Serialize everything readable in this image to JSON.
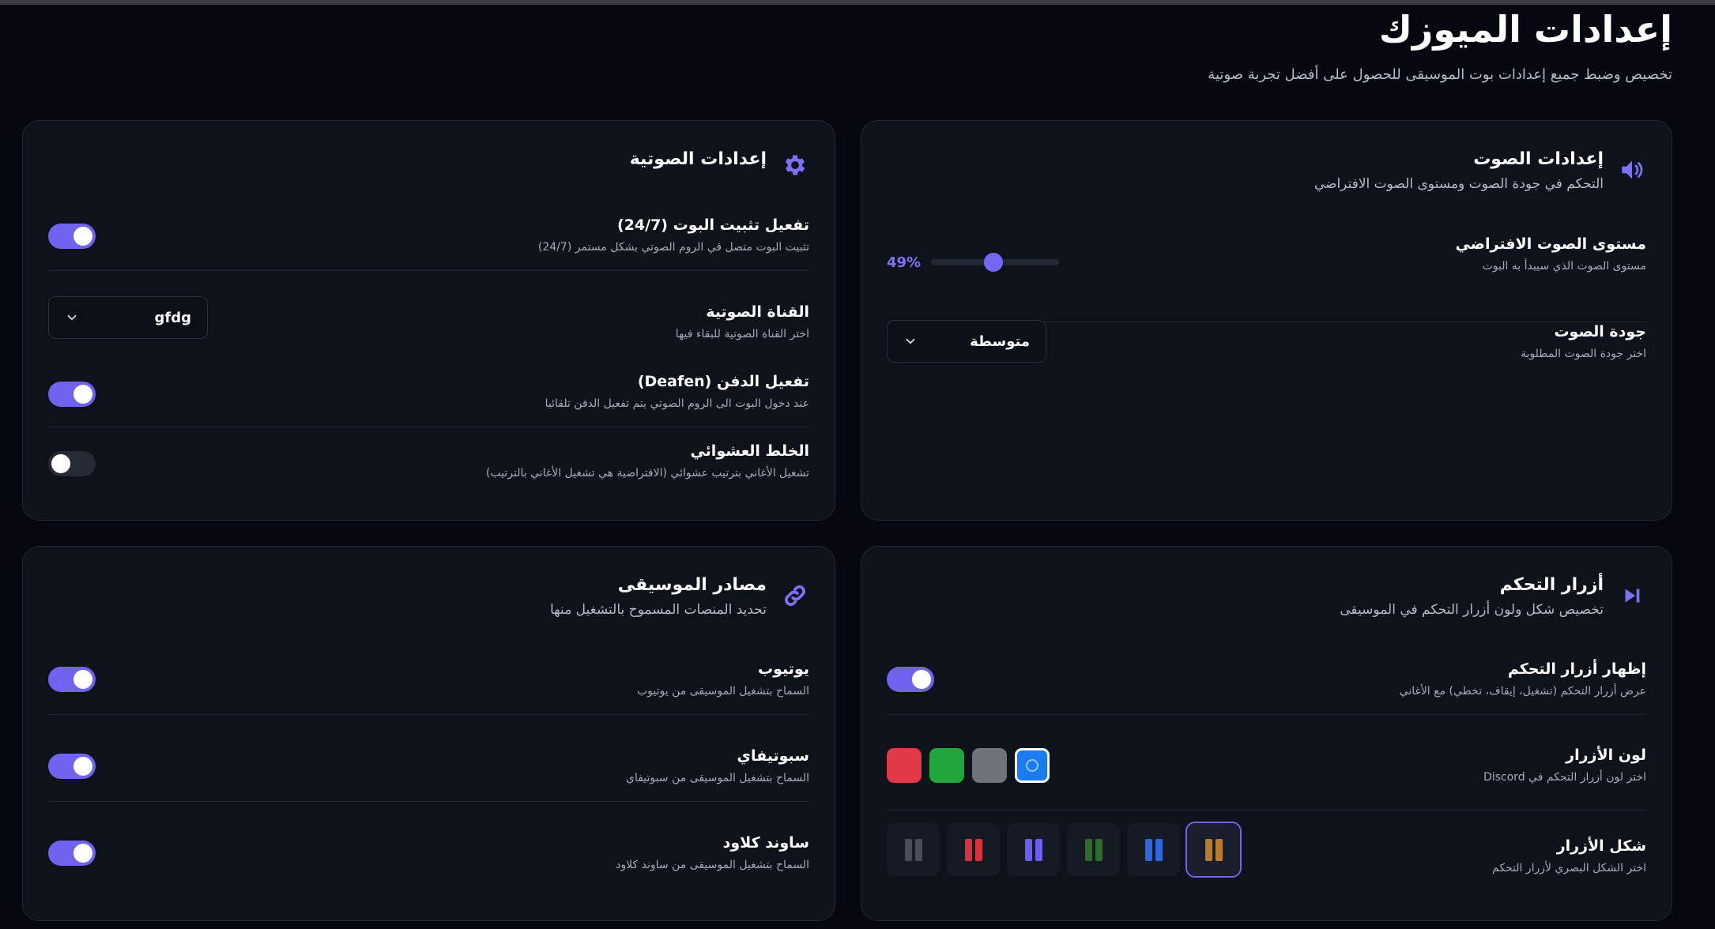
{
  "page": {
    "title": "إعدادات الميوزك",
    "subtitle": "تخصيص وضبط جميع إعدادات بوت الموسيقى للحصول على أفضل تجربة صوتية"
  },
  "audio_settings": {
    "icon": "speaker-icon",
    "title": "إعدادات الصوت",
    "description": "التحكم في جودة الصوت ومستوى الصوت الافتراضي",
    "volume": {
      "label": "مستوى الصوت الافتراضي",
      "description": "مستوى الصوت الذي سيبدأ به البوت",
      "display": "49%",
      "value": 49
    },
    "quality": {
      "label": "جودة الصوت",
      "description": "اختر جودة الصوت المطلوبة",
      "selected": "متوسطة"
    }
  },
  "voice_settings": {
    "icon": "gear-icon",
    "title": "إعدادات الصوتية",
    "stay_247": {
      "label": "تفعيل تثبيت البوت (24/7)",
      "description": "تثبيت البوت متصل في الروم الصوتي بشكل مستمر (24/7)",
      "enabled": true
    },
    "voice_channel": {
      "label": "القناة الصوتية",
      "description": "اختر القناة الصوتية للبقاء فيها",
      "selected": "gfdg"
    },
    "deafen": {
      "label": "تفعيل الدفن (Deafen)",
      "description": "عند دخول البوت الى الروم الصوتي يتم تفعيل الدفن تلقائيا",
      "enabled": true
    },
    "shuffle": {
      "label": "الخلط العشوائي",
      "description": "تشغيل الأغاني بترتيب عشوائي (الافتراضية هي تشغيل الأغاني بالترتيب)",
      "enabled": false
    }
  },
  "control_buttons": {
    "icon": "play-next-icon",
    "title": "أزرار التحكم",
    "description": "تخصيص شكل ولون أزرار التحكم في الموسيقى",
    "show": {
      "label": "إظهار أزرار التحكم",
      "description": "عرض أزرار التحكم (تشغيل، إيقاف، تخطي) مع الأغاني",
      "enabled": true
    },
    "color": {
      "label": "لون الأزرار",
      "description": "اختر لون أزرار التحكم في Discord",
      "options": [
        "#e03a48",
        "#23a53d",
        "#6f737a",
        "#1a7cf0"
      ],
      "selected_index": 3
    },
    "style": {
      "label": "شكل الأزرار",
      "description": "اختر الشكل البصري لأزرار التحكم",
      "options": [
        [
          "#4a4e57",
          "#4a4e57"
        ],
        [
          "#d8343f",
          "#d8343f"
        ],
        [
          "#6b5ff0",
          "#6b5ff0"
        ],
        [
          "#2e6b2c",
          "#2e6b2c"
        ],
        [
          "#2f66e0",
          "#2f66e0"
        ],
        [
          "#b97a2b",
          "#b97a2b"
        ]
      ],
      "selected_index": 5
    }
  },
  "music_sources": {
    "icon": "link-icon",
    "title": "مصادر الموسيقى",
    "description": "تحديد المنصات المسموح بالتشغيل منها",
    "youtube": {
      "label": "يوتيوب",
      "description": "السماح بتشغيل الموسيقى من يوتيوب",
      "enabled": true
    },
    "spotify": {
      "label": "سبوتيفاي",
      "description": "السماح بتشغيل الموسيقى من سبوتيفاي",
      "enabled": true
    },
    "soundcloud": {
      "label": "ساوند كلاود",
      "description": "السماح بتشغيل الموسيقى من ساوند كلاود",
      "enabled": true
    }
  },
  "colors": {
    "accent": "#6f63f0",
    "background": "#050810",
    "card": "#0e121b"
  }
}
